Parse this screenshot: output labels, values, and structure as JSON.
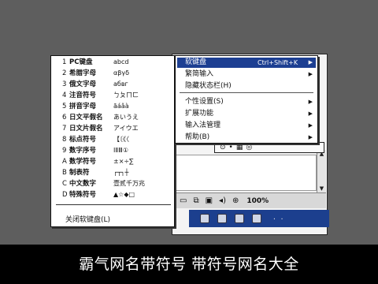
{
  "caption": "霸气网名带符号 带符号网名大全",
  "menu": {
    "items": [
      {
        "num": "1",
        "name": "PC键盘",
        "example": "abcd"
      },
      {
        "num": "2",
        "name": "希腊字母",
        "example": "αβγδ"
      },
      {
        "num": "3",
        "name": "俄文字母",
        "example": "абвг"
      },
      {
        "num": "4",
        "name": "注音符号",
        "example": "ㄅㄆㄇㄈ"
      },
      {
        "num": "5",
        "name": "拼音字母",
        "example": "āáǎà"
      },
      {
        "num": "6",
        "name": "日文平假名",
        "example": "あいうえ"
      },
      {
        "num": "7",
        "name": "日文片假名",
        "example": "アイウエ"
      },
      {
        "num": "8",
        "name": "标点符号",
        "example": "【〔《〈"
      },
      {
        "num": "9",
        "name": "数字序号",
        "example": "ⅠⅡⅢ①"
      },
      {
        "num": "A",
        "name": "数学符号",
        "example": "±×÷∑"
      },
      {
        "num": "B",
        "name": "制表符",
        "example": "┌┬┐┼"
      },
      {
        "num": "C",
        "name": "中文数字",
        "example": "壹贰千万兆"
      },
      {
        "num": "D",
        "name": "特殊符号",
        "example": "▲☆◆□"
      }
    ],
    "footer": "关闭软键盘(L)"
  },
  "submenu": {
    "items": [
      {
        "label": "软键盘",
        "hint": "Ctrl+Shift+K",
        "arrow": true,
        "highlight": true
      },
      {
        "label": "繁简输入",
        "hint": "",
        "arrow": true,
        "highlight": false
      },
      {
        "label": "隐藏状态栏(H)",
        "hint": "",
        "arrow": false,
        "highlight": false
      },
      {
        "label": "个性设置(S)",
        "hint": "",
        "arrow": true,
        "highlight": false
      },
      {
        "label": "扩展功能",
        "hint": "",
        "arrow": true,
        "highlight": false
      },
      {
        "label": "输入法管理",
        "hint": "",
        "arrow": true,
        "highlight": false
      },
      {
        "label": "帮助(B)",
        "hint": "",
        "arrow": true,
        "highlight": false
      }
    ]
  },
  "toolbar": {
    "zoom": "100%"
  },
  "icons": {
    "arrow": "▶",
    "scroll_up": "▲",
    "scroll_down": "▼"
  },
  "colors": {
    "highlight": "#1d3f92",
    "taskbar": "#1c3f8e",
    "desktop": "#5e5e5e"
  }
}
